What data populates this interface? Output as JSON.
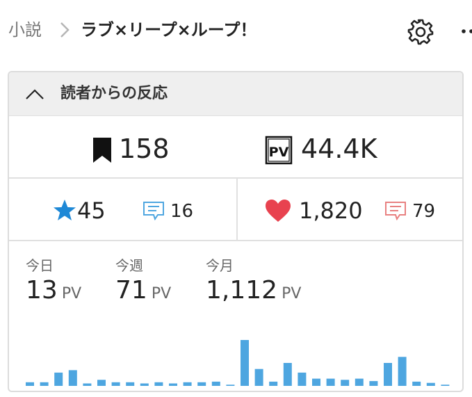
{
  "breadcrumb": {
    "parent": "小説",
    "title": "ラブ×リープ×ループ！"
  },
  "panel": {
    "title": "読者からの反応",
    "bookmarks": "158",
    "page_views": "44.4K",
    "stars": "45",
    "reviews": "16",
    "hearts": "1,820",
    "comments": "79"
  },
  "stats": {
    "today": {
      "label": "今日",
      "value": "13",
      "unit": "PV"
    },
    "week": {
      "label": "今週",
      "value": "71",
      "unit": "PV"
    },
    "month": {
      "label": "今月",
      "value": "1,112",
      "unit": "PV"
    }
  },
  "colors": {
    "accent": "#4ea6e0",
    "heart": "#e8424f",
    "comment": "#e88080",
    "star": "#1e88d6"
  },
  "chart_data": {
    "type": "bar",
    "values": [
      6,
      6,
      22,
      26,
      4,
      10,
      6,
      6,
      4,
      6,
      4,
      6,
      6,
      7,
      2,
      76,
      28,
      7,
      38,
      22,
      12,
      12,
      10,
      12,
      8,
      38,
      48,
      7,
      5,
      2
    ]
  }
}
